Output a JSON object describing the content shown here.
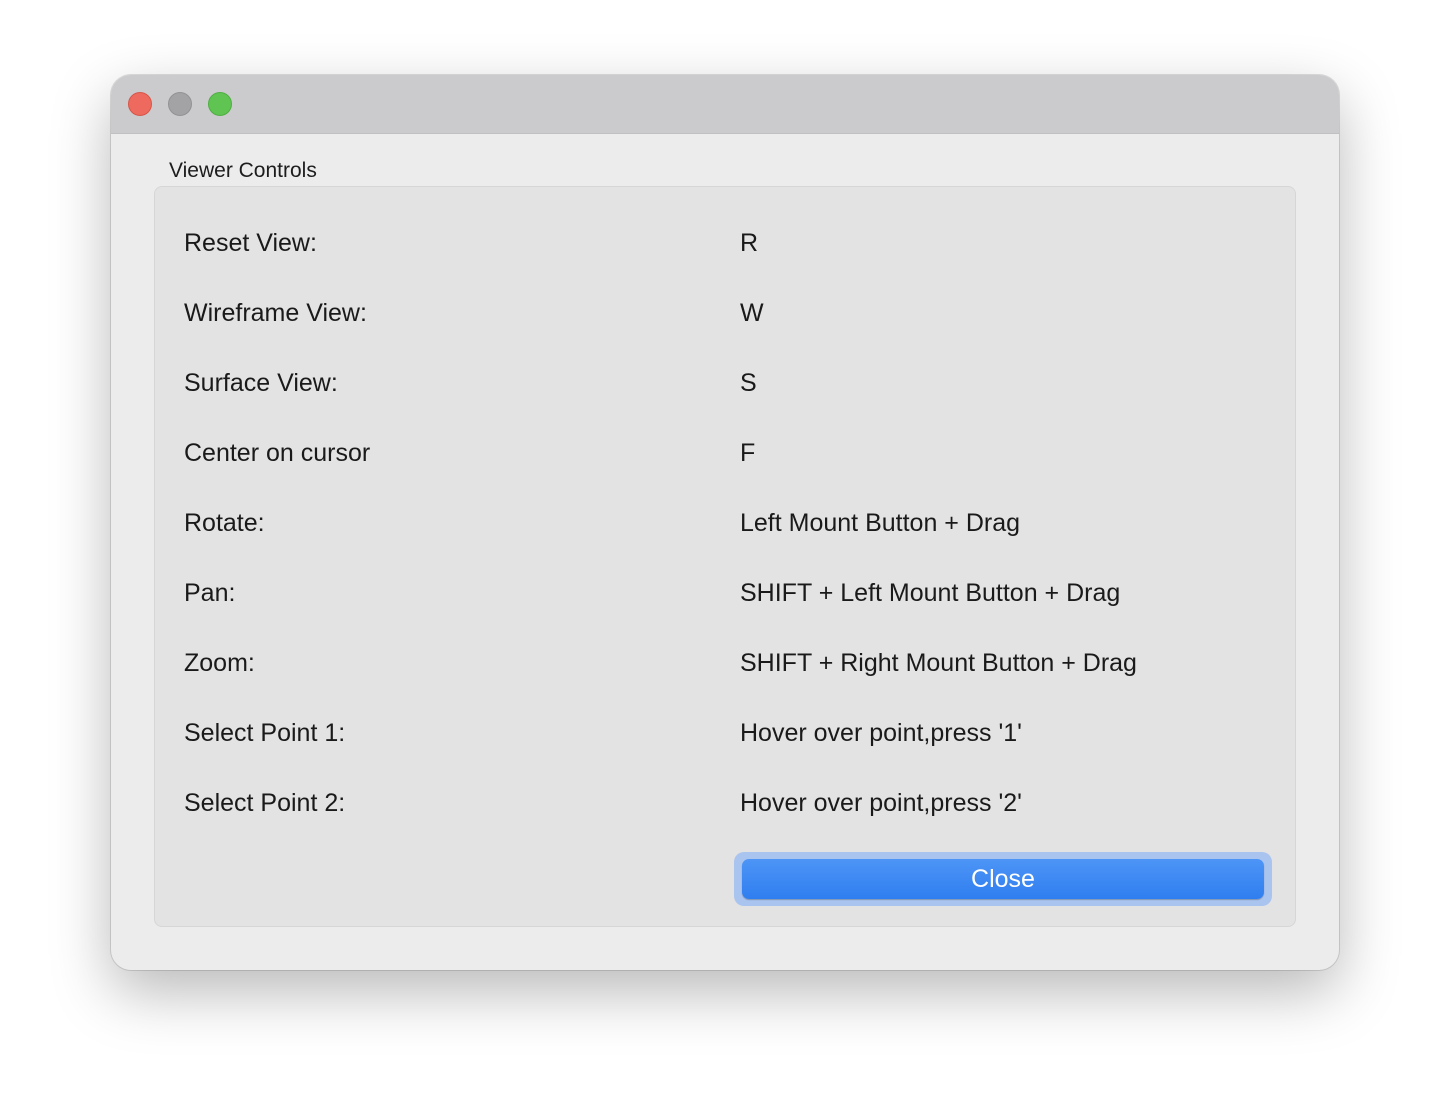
{
  "window": {
    "title": ""
  },
  "group": {
    "title": "Viewer Controls"
  },
  "controls": [
    {
      "label": "Reset View:",
      "value": "R"
    },
    {
      "label": "Wireframe View:",
      "value": "W"
    },
    {
      "label": "Surface View:",
      "value": "S"
    },
    {
      "label": "Center on cursor",
      "value": "F"
    },
    {
      "label": "Rotate:",
      "value": "Left Mount Button + Drag"
    },
    {
      "label": "Pan:",
      "value": "SHIFT + Left Mount Button + Drag"
    },
    {
      "label": "Zoom:",
      "value": "SHIFT + Right Mount Button + Drag"
    },
    {
      "label": "Select Point 1:",
      "value": "Hover over point,press '1'"
    },
    {
      "label": "Select Point 2:",
      "value": "Hover over point,press '2'"
    }
  ],
  "buttons": {
    "close_label": "Close"
  },
  "colors": {
    "accent": "#3b86f3",
    "traffic_close": "#ee6a5e",
    "traffic_minimize": "#a3a3a5",
    "traffic_zoom": "#60c453"
  }
}
